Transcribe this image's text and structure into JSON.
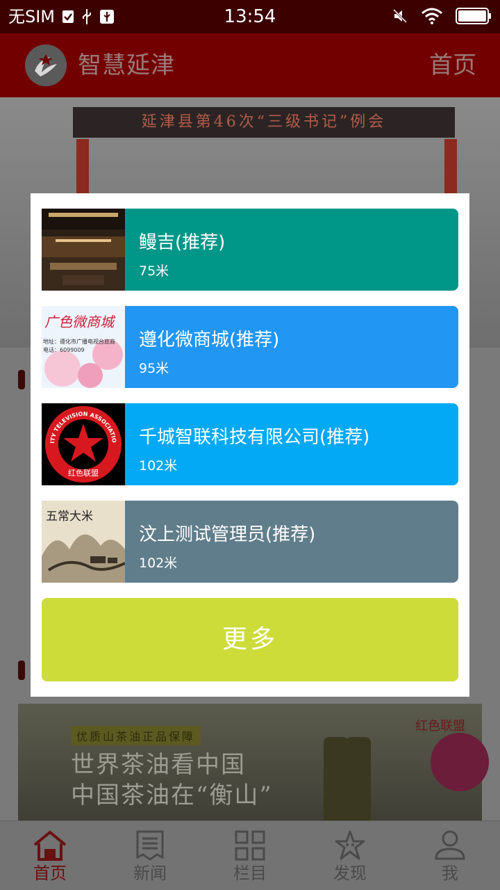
{
  "status_bar": {
    "carrier": "无SIM",
    "time": "13:54",
    "icons": [
      "checkbox-icon",
      "usb-icon",
      "usb-debug-icon",
      "mute-icon",
      "wifi-icon",
      "battery-icon"
    ]
  },
  "header": {
    "title": "智慧延津",
    "home_link": "首页"
  },
  "background": {
    "banner_text": "延津县第46次“三级书记”例会",
    "ad": {
      "tag": "优质山茶油正品保障",
      "line1": "世界茶油看中国",
      "line2": "中国茶油在“衡山”",
      "brand": "红色联盟"
    }
  },
  "dialog": {
    "items": [
      {
        "title": "鳗吉(推荐)",
        "distance": "75米",
        "color": "#009688",
        "thumb": "restaurant-interior-photo"
      },
      {
        "title": "遵化微商城(推荐)",
        "distance": "95米",
        "color": "#2196f3",
        "thumb": "micro-mall-poster",
        "thumb_text": {
          "heading": "广色微商城",
          "address": "地址：遵化市广播电视台底商",
          "phone": "电话：6099009"
        }
      },
      {
        "title": "千城智联科技有限公司(推荐)",
        "distance": "102米",
        "color": "#03a9f4",
        "thumb": "red-star-association-logo",
        "thumb_text": {
          "ring": "CITY TELEVISION ASSOCIATION",
          "bottom": "红色联盟"
        }
      },
      {
        "title": "汶上测试管理员(推荐)",
        "distance": "102米",
        "color": "#607d8b",
        "thumb": "rice-brand-ink-painting",
        "thumb_text": {
          "heading": "五常大米"
        }
      }
    ],
    "more_label": "更多"
  },
  "bottom_nav": [
    {
      "label": "首页",
      "icon": "home-icon",
      "active": true
    },
    {
      "label": "新闻",
      "icon": "news-icon",
      "active": false
    },
    {
      "label": "栏目",
      "icon": "grid-icon",
      "active": false
    },
    {
      "label": "发现",
      "icon": "discover-star-icon",
      "active": false
    },
    {
      "label": "我",
      "icon": "profile-icon",
      "active": false
    }
  ],
  "colors": {
    "status_bar": "#3d0000",
    "header": "#730000",
    "more_button": "#cddc39",
    "nav_active": "#6a1010"
  }
}
